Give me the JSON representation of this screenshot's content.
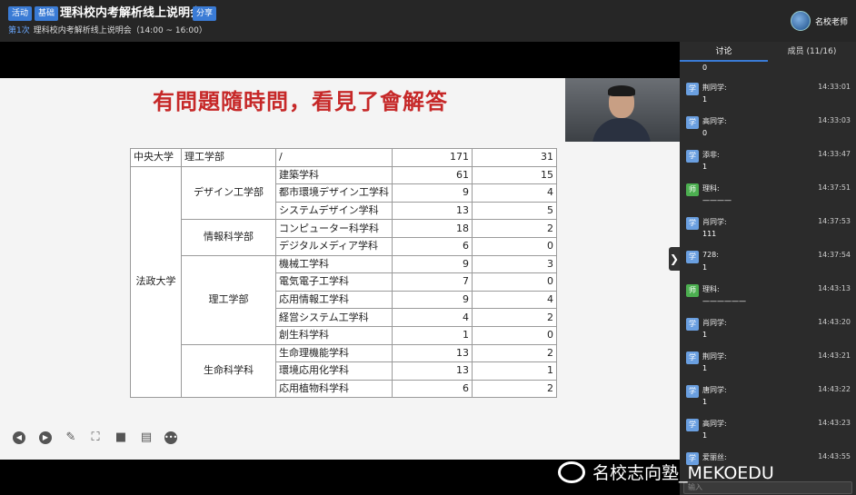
{
  "header": {
    "badge_activity": "活动",
    "badge_basic": "基础",
    "title": "理科校内考解析线上说明会",
    "share_label": "分享",
    "session_label": "第1次",
    "session_title": "理科校内考解析线上说明会（14:00 ~ 16:00）",
    "org_name": "名校老师"
  },
  "slide": {
    "heading": "有問題隨時問，看見了會解答",
    "table": {
      "row0": [
        "中央大学",
        "理工学部",
        "/",
        "171",
        "31"
      ],
      "university": "法政大学",
      "groups": [
        {
          "faculty": "デザイン工学部",
          "rows": [
            [
              "建築学科",
              "61",
              "15"
            ],
            [
              "都市環境デザイン工学科",
              "9",
              "4"
            ],
            [
              "システムデザイン学科",
              "13",
              "5"
            ]
          ]
        },
        {
          "faculty": "情報科学部",
          "rows": [
            [
              "コンピューター科学科",
              "18",
              "2"
            ],
            [
              "デジタルメディア学科",
              "6",
              "0"
            ]
          ]
        },
        {
          "faculty": "理工学部",
          "rows": [
            [
              "機械工学科",
              "9",
              "3"
            ],
            [
              "電気電子工学科",
              "7",
              "0"
            ],
            [
              "応用情報工学科",
              "9",
              "4"
            ],
            [
              "経営システム工学科",
              "4",
              "2"
            ],
            [
              "創生科学科",
              "1",
              "0"
            ]
          ]
        },
        {
          "faculty": "生命科学科",
          "rows": [
            [
              "生命理機能学科",
              "13",
              "2"
            ],
            [
              "環境応用化学科",
              "13",
              "1"
            ],
            [
              "応用植物科学科",
              "6",
              "2"
            ]
          ]
        }
      ]
    }
  },
  "sidebar": {
    "tab_discussion": "讨论",
    "tab_members": "成员 (11/16)",
    "prev_text": "0",
    "messages": [
      {
        "avatar": "学",
        "name": "荆同学:",
        "time": "14:33:01",
        "text": "1",
        "avatar_color": "blue"
      },
      {
        "avatar": "学",
        "name": "高同学:",
        "time": "14:33:03",
        "text": "0",
        "avatar_color": "blue"
      },
      {
        "avatar": "学",
        "name": "添非:",
        "time": "14:33:47",
        "text": "1",
        "avatar_color": "blue"
      },
      {
        "avatar": "师",
        "name": "理科:",
        "time": "14:37:51",
        "text": "————",
        "avatar_color": "green"
      },
      {
        "avatar": "学",
        "name": "肖同学:",
        "time": "14:37:53",
        "text": "111",
        "avatar_color": "blue"
      },
      {
        "avatar": "学",
        "name": "728:",
        "time": "14:37:54",
        "text": "1",
        "avatar_color": "blue"
      },
      {
        "avatar": "师",
        "name": "理科:",
        "time": "14:43:13",
        "text": "——————",
        "avatar_color": "green"
      },
      {
        "avatar": "学",
        "name": "肖同学:",
        "time": "14:43:20",
        "text": "1",
        "avatar_color": "blue"
      },
      {
        "avatar": "学",
        "name": "荆同学:",
        "time": "14:43:21",
        "text": "1",
        "avatar_color": "blue"
      },
      {
        "avatar": "学",
        "name": "唐同学:",
        "time": "14:43:22",
        "text": "1",
        "avatar_color": "blue"
      },
      {
        "avatar": "学",
        "name": "高同学:",
        "time": "14:43:23",
        "text": "1",
        "avatar_color": "blue"
      },
      {
        "avatar": "学",
        "name": "爱丽丝:",
        "time": "14:43:55",
        "text": "",
        "avatar_color": "blue"
      }
    ],
    "input_placeholder": "输入"
  },
  "toolbar": {
    "icons": [
      "prev-icon",
      "play-icon",
      "pen-icon",
      "screenshot-icon",
      "camera-icon",
      "chat-icon",
      "more-icon"
    ]
  },
  "watermark": {
    "text": "名校志向塾_MEKOEDU"
  },
  "colors": {
    "accent": "#3a7bd5",
    "heading_red": "#c62828",
    "teacher_green": "#4caf50"
  }
}
